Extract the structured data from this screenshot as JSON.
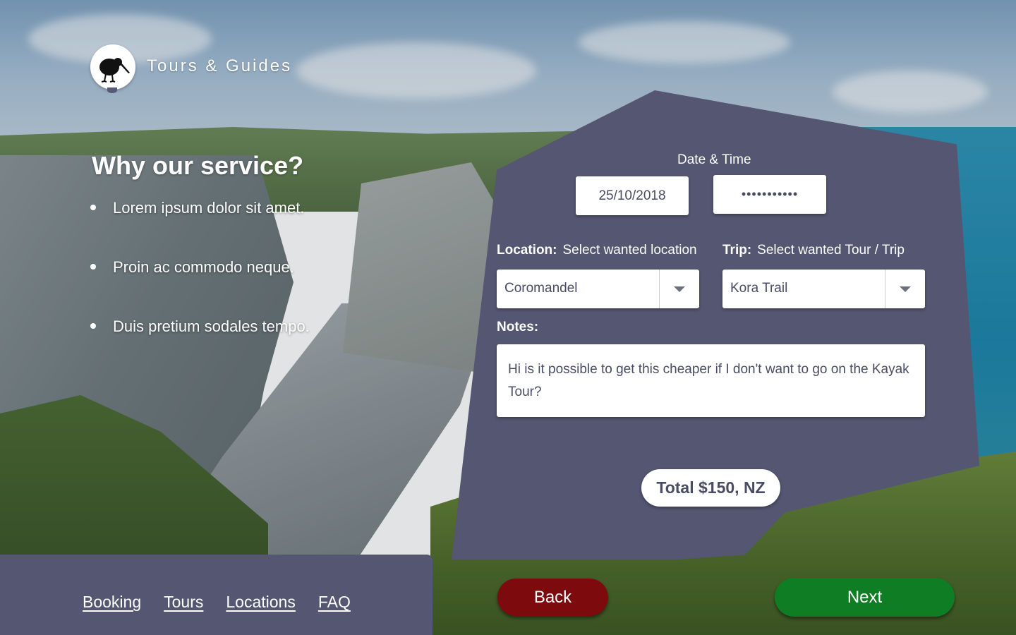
{
  "brand": {
    "name": "Tours & Guides",
    "logo_icon": "kiwi-bird-icon"
  },
  "why": {
    "title": "Why our service?",
    "items": [
      "Lorem ipsum dolor sit amet.",
      "Proin ac commodo neque.",
      "Duis pretium sodales tempo."
    ]
  },
  "form": {
    "datetime_label": "Date & Time",
    "date_value": "25/10/2018",
    "time_value": "•••••••••••",
    "location": {
      "label": "Location:",
      "hint": "Select wanted location",
      "value": "Coromandel"
    },
    "trip": {
      "label": "Trip:",
      "hint": "Select wanted Tour / Trip",
      "value": "Kora Trail"
    },
    "notes_label": "Notes:",
    "notes_value": "Hi is it possible to get this cheaper if I don't want to go on the Kayak Tour?",
    "total": "Total $150, NZ"
  },
  "footer": {
    "links": [
      "Booking",
      "Tours",
      "Locations",
      "FAQ"
    ]
  },
  "buttons": {
    "back": "Back",
    "next": "Next"
  },
  "colors": {
    "panel": "#545672",
    "back_button": "#7d0b0d",
    "next_button": "#0f7d24",
    "input_text": "#4a4c63"
  }
}
